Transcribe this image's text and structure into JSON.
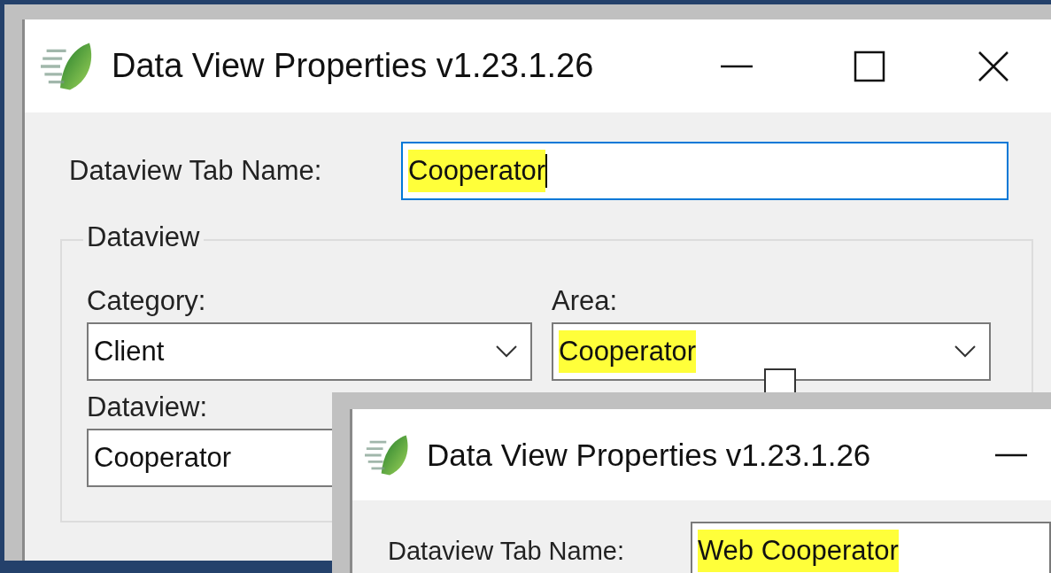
{
  "background_window": {
    "title": "Data View Properties v1.23.1.26",
    "tab_name": {
      "label": "Dataview Tab Name:",
      "value": "Cooperator",
      "highlighted": true,
      "focused": true
    },
    "dataview_group": {
      "title": "Dataview",
      "category": {
        "label": "Category:",
        "value": "Client",
        "highlighted": false
      },
      "area": {
        "label": "Area:",
        "value": "Cooperator",
        "highlighted": true
      },
      "dataview": {
        "label": "Dataview:",
        "value": "Cooperator",
        "highlighted": false
      },
      "show_all_checked": false
    }
  },
  "front_window": {
    "title": "Data View Properties v1.23.1.26",
    "tab_name": {
      "label": "Dataview Tab Name:",
      "value": "Web Cooperator",
      "highlighted": true,
      "focused": false
    }
  }
}
